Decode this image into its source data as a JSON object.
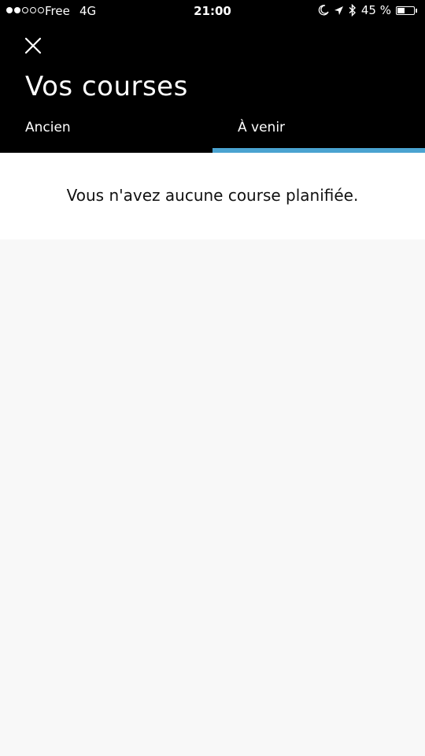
{
  "status_bar": {
    "carrier": "Free",
    "network": "4G",
    "time": "21:00",
    "battery_percent": "45 %",
    "battery_level": 0.45,
    "signal_bars": 2,
    "icons": [
      "moon-icon",
      "location-arrow-icon",
      "bluetooth-icon",
      "battery-icon"
    ]
  },
  "header": {
    "title": "Vos courses",
    "close_icon": "close-icon"
  },
  "tabs": [
    {
      "label": "Ancien",
      "selected": false
    },
    {
      "label": "À venir",
      "selected": true
    }
  ],
  "colors": {
    "header_bg": "#000000",
    "accent": "#4aa3d0",
    "content_bg": "#f8f8f8"
  },
  "content": {
    "empty_message": "Vous n'avez aucune course planifiée."
  }
}
